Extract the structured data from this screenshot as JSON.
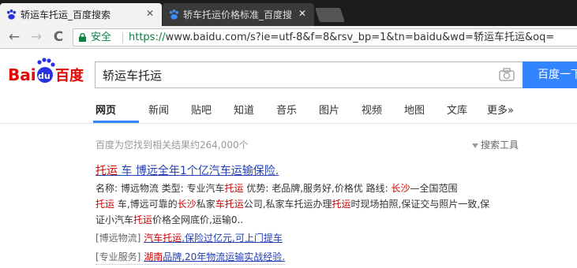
{
  "browser": {
    "tabs": [
      {
        "title": "轿运车托运_百度搜索",
        "active": true
      },
      {
        "title": "轿车托运价格标准_百度搜",
        "active": false
      }
    ],
    "close_glyph": "✕",
    "nav": {
      "back": "←",
      "forward": "→",
      "reload": "C"
    },
    "secure_label": "安全",
    "url_scheme": "https://",
    "url_rest": "www.baidu.com/s?ie=utf-8&f=8&rsv_bp=1&tn=baidu&wd=轿运车托运&oq="
  },
  "search": {
    "query": "轿运车托运",
    "button": "百度一下"
  },
  "logo": {
    "bai": "Bai",
    "du": "du",
    "cn": "百度"
  },
  "tabs": [
    "网页",
    "新闻",
    "贴吧",
    "知道",
    "音乐",
    "图片",
    "视频",
    "地图",
    "文库",
    "更多»"
  ],
  "results": {
    "stats": "百度为您找到相关结果约264,000个",
    "tools": "搜索工具",
    "first": {
      "title_em": "托运",
      "title_mid": " 车 博远全年1个亿汽车运输保险.",
      "line1": {
        "a": "名称: 博远物流    类型: 专业汽车",
        "em1": "托运",
        "b": "    优势: 老品牌,服务好,价格优    路线: ",
        "em2": "长沙",
        "c": "—全国范围"
      },
      "line2": {
        "em1": "托运",
        "a": " 车,博远可靠的",
        "em2": "长沙",
        "b": "私家",
        "em3": "车托运",
        "c": "公司,私家车托运办理",
        "em4": "托运",
        "d": "时现场拍照,保证交与照片一致,保"
      },
      "line3": {
        "a": "证小汽车",
        "em1": "托运",
        "b": "价格全网底价,运输0.."
      },
      "sitelink1": {
        "label": "[博远物流]",
        "link_em": "汽车托运",
        "link_rest": ",保险过亿元,可上门提车"
      },
      "sitelink2": {
        "label": "[专业服务]",
        "link_em": "湖南",
        "link_rest": "品牌,20年物流运输实战经验."
      }
    }
  },
  "colors": {
    "accent": "#3385ff",
    "link": "#2440b3",
    "em": "#cc0000",
    "secure": "#0b8043"
  }
}
